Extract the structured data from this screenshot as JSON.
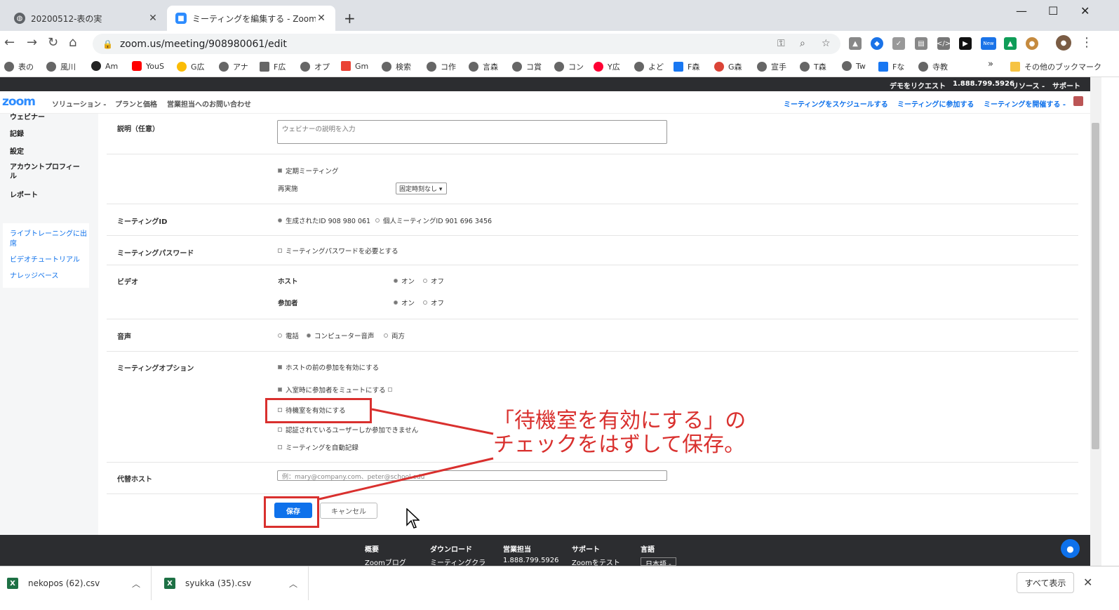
{
  "browser": {
    "tabs": [
      {
        "title": "20200512-表の実"
      },
      {
        "title": "ミーティングを編集する - Zoom"
      }
    ],
    "url": "zoom.us/meeting/908980061/edit",
    "bookmarks": [
      "表の",
      "風川",
      "Am",
      "YouS",
      "G広",
      "アナ",
      "F広",
      "オプ",
      "Gm",
      "検索",
      "コ作",
      "言森",
      "コ賞",
      "コン",
      "Y広",
      "よど",
      "F森",
      "G森",
      "宣手",
      "T森",
      "Tw",
      "Fな",
      "寺教"
    ],
    "bookmarks_other": "その他のブックマーク",
    "ext_new_badge": "New"
  },
  "zoom": {
    "topstrip": {
      "demo": "デモをリクエスト",
      "phone": "1.888.799.5926",
      "resources": "リソース -",
      "support": "サポート"
    },
    "nav": {
      "logo": "zoom",
      "solutions": "ソリューション -",
      "plans": "プランと価格",
      "contact_sales": "営業担当へのお問い合わせ",
      "schedule": "ミーティングをスケジュールする",
      "join": "ミーティングに参加する",
      "host": "ミーティングを開催する -"
    },
    "sidebar": {
      "items": [
        "ウェビナー",
        "記録",
        "設定",
        "アカウントプロフィール",
        "レポート"
      ],
      "links": [
        "ライブトレーニングに出席",
        "ビデオチュートリアル",
        "ナレッジベース"
      ]
    },
    "form": {
      "description": {
        "label": "説明（任意）",
        "placeholder": "ウェビナーの説明を入力"
      },
      "recurring": {
        "label": "定期ミーティング",
        "reschedule_label": "再実施",
        "reschedule_value": "固定時刻なし"
      },
      "meeting_id": {
        "label": "ミーティングID",
        "generated": "生成されたID 908 980 061",
        "personal": "個人ミーティングID 901 696 3456"
      },
      "password": {
        "label": "ミーティングパスワード",
        "option": "ミーティングパスワードを必要とする"
      },
      "video": {
        "label": "ビデオ",
        "host_label": "ホスト",
        "participant_label": "参加者",
        "on": "オン",
        "off": "オフ"
      },
      "audio": {
        "label": "音声",
        "phone": "電話",
        "computer": "コンピューター音声",
        "both": "両方"
      },
      "options": {
        "label": "ミーティングオプション",
        "join_before_host": "ホストの前の参加を有効にする",
        "mute_on_entry": "入室時に参加者をミュートにする",
        "waiting_room": "待機室を有効にする",
        "auth_only": "認証されているユーザーしか参加できません",
        "auto_record": "ミーティングを自動記録"
      },
      "alt_host": {
        "label": "代替ホスト",
        "placeholder": "例：mary@company.com、peter@school.edu"
      },
      "save": "保存",
      "cancel": "キャンセル"
    },
    "footer": {
      "cols": [
        "概要",
        "ダウンロード",
        "営業担当",
        "サポート",
        "言語"
      ],
      "row2": [
        "Zoomブログ",
        "ミーティングクラ",
        "1.888.799.5926",
        "Zoomをテスト",
        "日本語 -"
      ]
    }
  },
  "downloads": {
    "items": [
      "nekopos (62).csv",
      "syukka (35).csv"
    ],
    "show_all": "すべて表示"
  },
  "annotation": {
    "line1": "「待機室を有効にする」の",
    "line2": "チェックをはずして保存。",
    "color": "#d9302e"
  }
}
